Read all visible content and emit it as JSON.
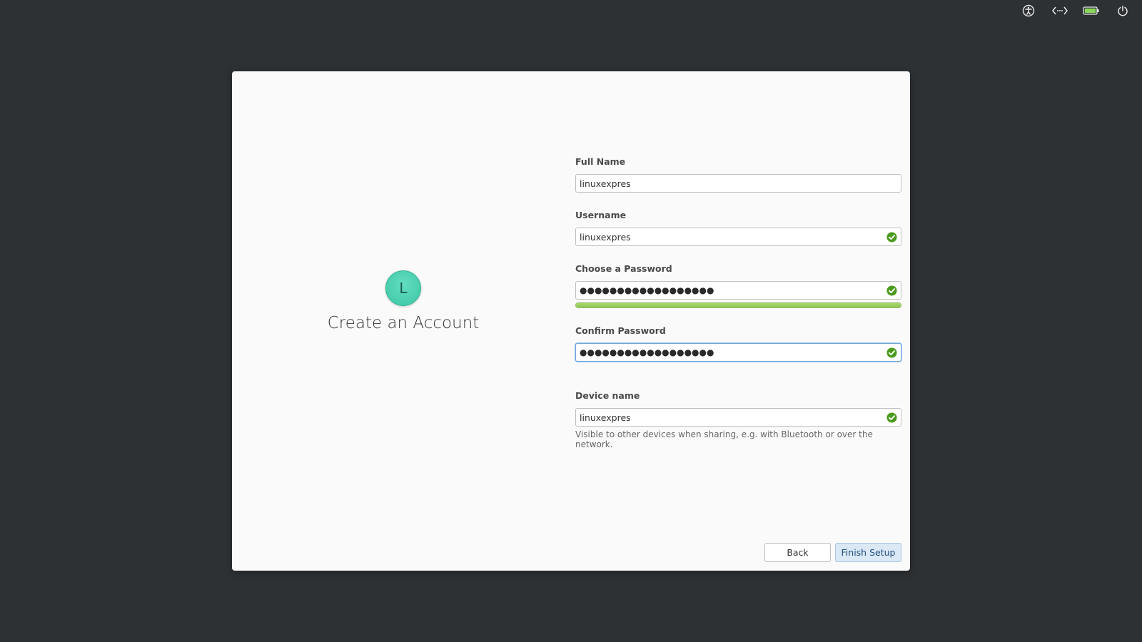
{
  "system_tray": {
    "icons": [
      "accessibility-icon",
      "network-icon",
      "battery-icon",
      "power-icon"
    ],
    "battery_level": 1.0,
    "battery_color": "#8bd65a"
  },
  "dialog": {
    "avatar_initial": "L",
    "avatar_color": "#4dd4b4",
    "title": "Create an Account",
    "fields": {
      "full_name": {
        "label": "Full Name",
        "value": "linuxexpres"
      },
      "username": {
        "label": "Username",
        "value": "linuxexpres",
        "valid": true
      },
      "password": {
        "label": "Choose a Password",
        "value": "●●●●●●●●●●●●●●●●●●",
        "valid": true,
        "strength": 1.0,
        "strength_color": "#8dc653"
      },
      "confirm_password": {
        "label": "Confirm Password",
        "value": "●●●●●●●●●●●●●●●●●●",
        "valid": true,
        "focused": true
      },
      "device_name": {
        "label": "Device name",
        "value": "linuxexpres",
        "valid": true,
        "help": "Visible to other devices when sharing, e.g. with Bluetooth or over the network."
      }
    },
    "buttons": {
      "back": "Back",
      "finish": "Finish Setup"
    },
    "check_color": "#4c9a1e"
  }
}
